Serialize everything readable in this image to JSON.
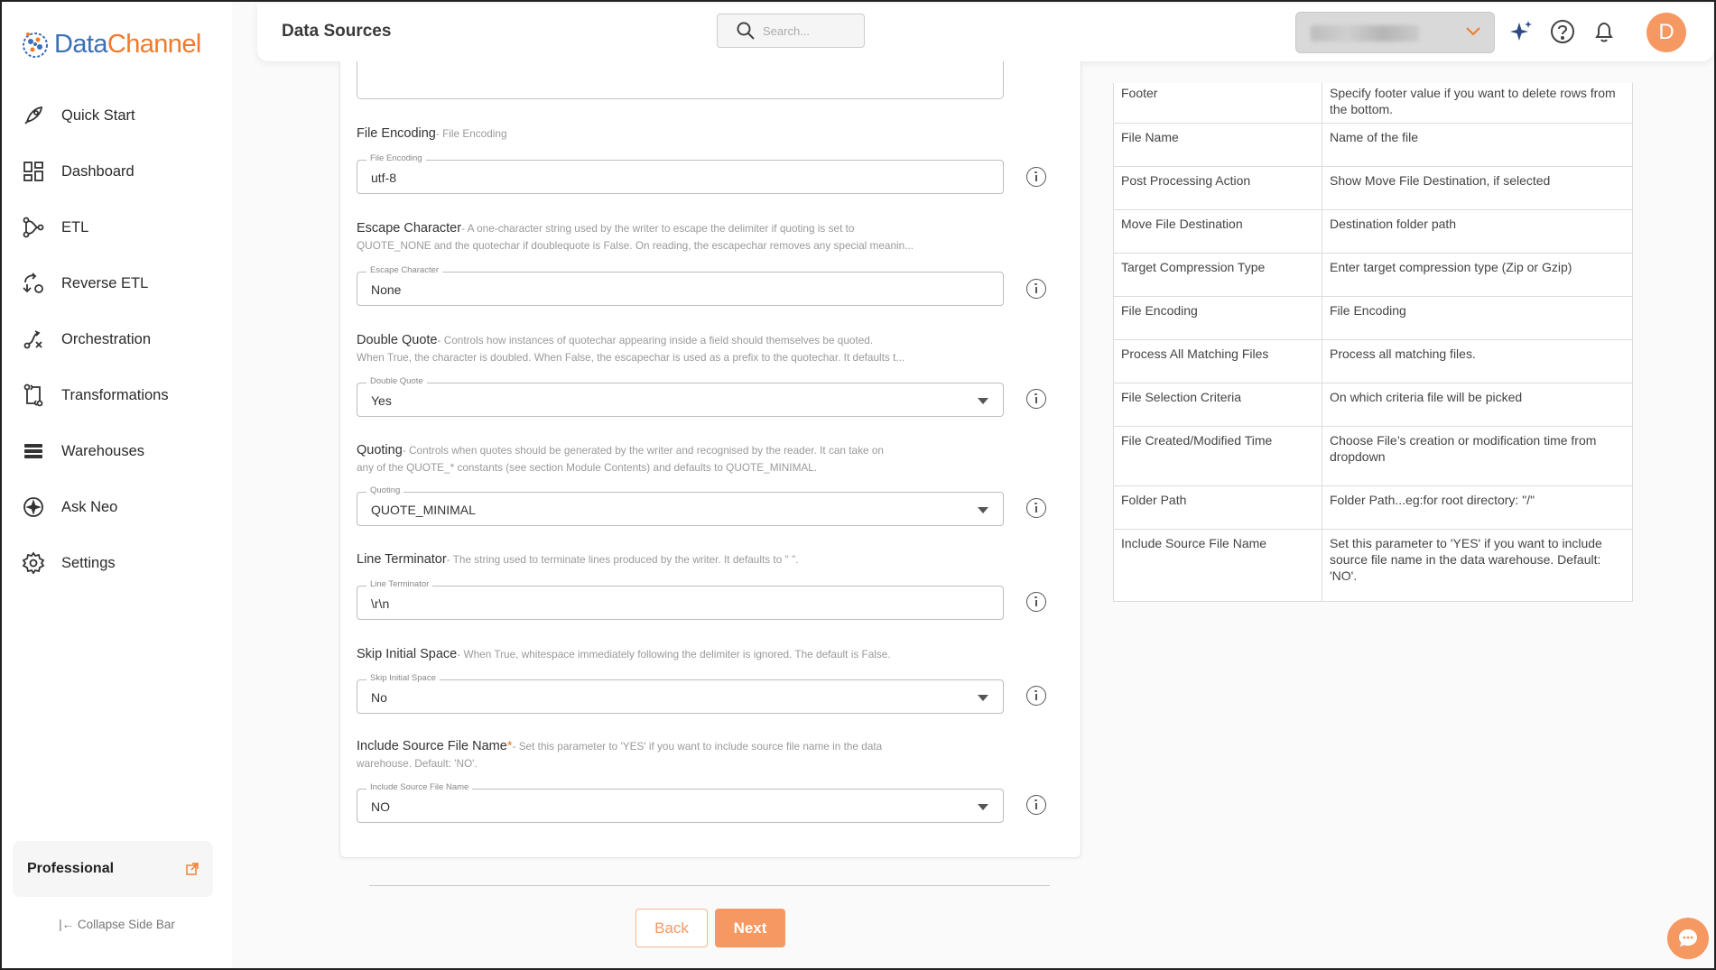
{
  "app": {
    "brand_part1": "Data",
    "brand_part2": "Channel"
  },
  "sidebar": {
    "items": [
      {
        "label": "Quick Start",
        "icon": "rocket-icon"
      },
      {
        "label": "Dashboard",
        "icon": "dashboard-icon"
      },
      {
        "label": "ETL",
        "icon": "etl-icon"
      },
      {
        "label": "Reverse ETL",
        "icon": "reverse-etl-icon"
      },
      {
        "label": "Orchestration",
        "icon": "orchestration-icon"
      },
      {
        "label": "Transformations",
        "icon": "transformations-icon"
      },
      {
        "label": "Warehouses",
        "icon": "warehouses-icon"
      },
      {
        "label": "Ask Neo",
        "icon": "ask-neo-icon"
      },
      {
        "label": "Settings",
        "icon": "gear-icon"
      }
    ],
    "plan_label": "Professional",
    "collapse_label": "Collapse Side Bar"
  },
  "header": {
    "title": "Data Sources",
    "search_placeholder": "Search...",
    "avatar_initial": "D"
  },
  "form": {
    "fields": [
      {
        "title": "File Encoding",
        "desc": "- File Encoding",
        "desc2": "",
        "label": "File Encoding",
        "value": "utf-8",
        "type": "text"
      },
      {
        "title": "Escape Character",
        "desc": "- A one-character string used by the writer to escape the delimiter if quoting is set to",
        "desc2": "QUOTE_NONE and the quotechar if doublequote is False. On reading, the escapechar removes any special meanin...",
        "label": "Escape Character",
        "value": "None",
        "type": "text"
      },
      {
        "title": "Double Quote",
        "desc": "- Controls how instances of quotechar appearing inside a field should themselves be quoted.",
        "desc2": "When True, the character is doubled. When False, the escapechar is used as a prefix to the quotechar. It defaults t...",
        "label": "Double Quote",
        "value": "Yes",
        "type": "select"
      },
      {
        "title": "Quoting",
        "desc": "- Controls when quotes should be generated by the writer and recognised by the reader. It can take on",
        "desc2": "any of the QUOTE_* constants (see section Module Contents) and defaults to QUOTE_MINIMAL.",
        "label": "Quoting",
        "value": "QUOTE_MINIMAL",
        "type": "select"
      },
      {
        "title": "Line Terminator",
        "desc": "- The string used to terminate lines produced by the writer. It defaults to \" \".",
        "desc2": "",
        "label": "Line Terminator",
        "value": "\\r\\n",
        "type": "text"
      },
      {
        "title": "Skip Initial Space",
        "desc": "- When True, whitespace immediately following the delimiter is ignored. The default is False.",
        "desc2": "",
        "label": "Skip Initial Space",
        "value": "No",
        "type": "select"
      },
      {
        "title": "Include Source File Name",
        "desc": "- Set this parameter to 'YES' if you want to include source file name in the data",
        "desc2": "warehouse. Default: 'NO'.",
        "label": "Include Source File Name",
        "value": "NO",
        "type": "select",
        "required": "*"
      }
    ],
    "back_label": "Back",
    "next_label": "Next"
  },
  "help_table": {
    "rows": [
      {
        "name": "Footer",
        "desc": "Specify footer value if you want to delete rows from the bottom."
      },
      {
        "name": "File Name",
        "desc": "Name of the file"
      },
      {
        "name": "Post Processing Action",
        "desc": "Show Move File Destination, if selected"
      },
      {
        "name": "Move File Destination",
        "desc": "Destination folder path"
      },
      {
        "name": "Target Compression Type",
        "desc": "Enter target compression type (Zip or Gzip)"
      },
      {
        "name": "File Encoding",
        "desc": "File Encoding"
      },
      {
        "name": "Process All Matching Files",
        "desc": "Process all matching files."
      },
      {
        "name": "File Selection Criteria",
        "desc": "On which criteria file will be picked"
      },
      {
        "name": "File Created/Modified Time",
        "desc": "Choose File’s creation or modification time from dropdown"
      },
      {
        "name": "Folder Path",
        "desc": "Folder Path...eg:for root directory: \"/\""
      },
      {
        "name": "Include Source File Name",
        "desc": "Set this parameter to 'YES' if you want to include source file name in the data warehouse. Default: 'NO'."
      }
    ]
  },
  "colors": {
    "accent": "#f59862",
    "brand_blue": "#3b6fb6",
    "brand_orange": "#f07a2b"
  }
}
